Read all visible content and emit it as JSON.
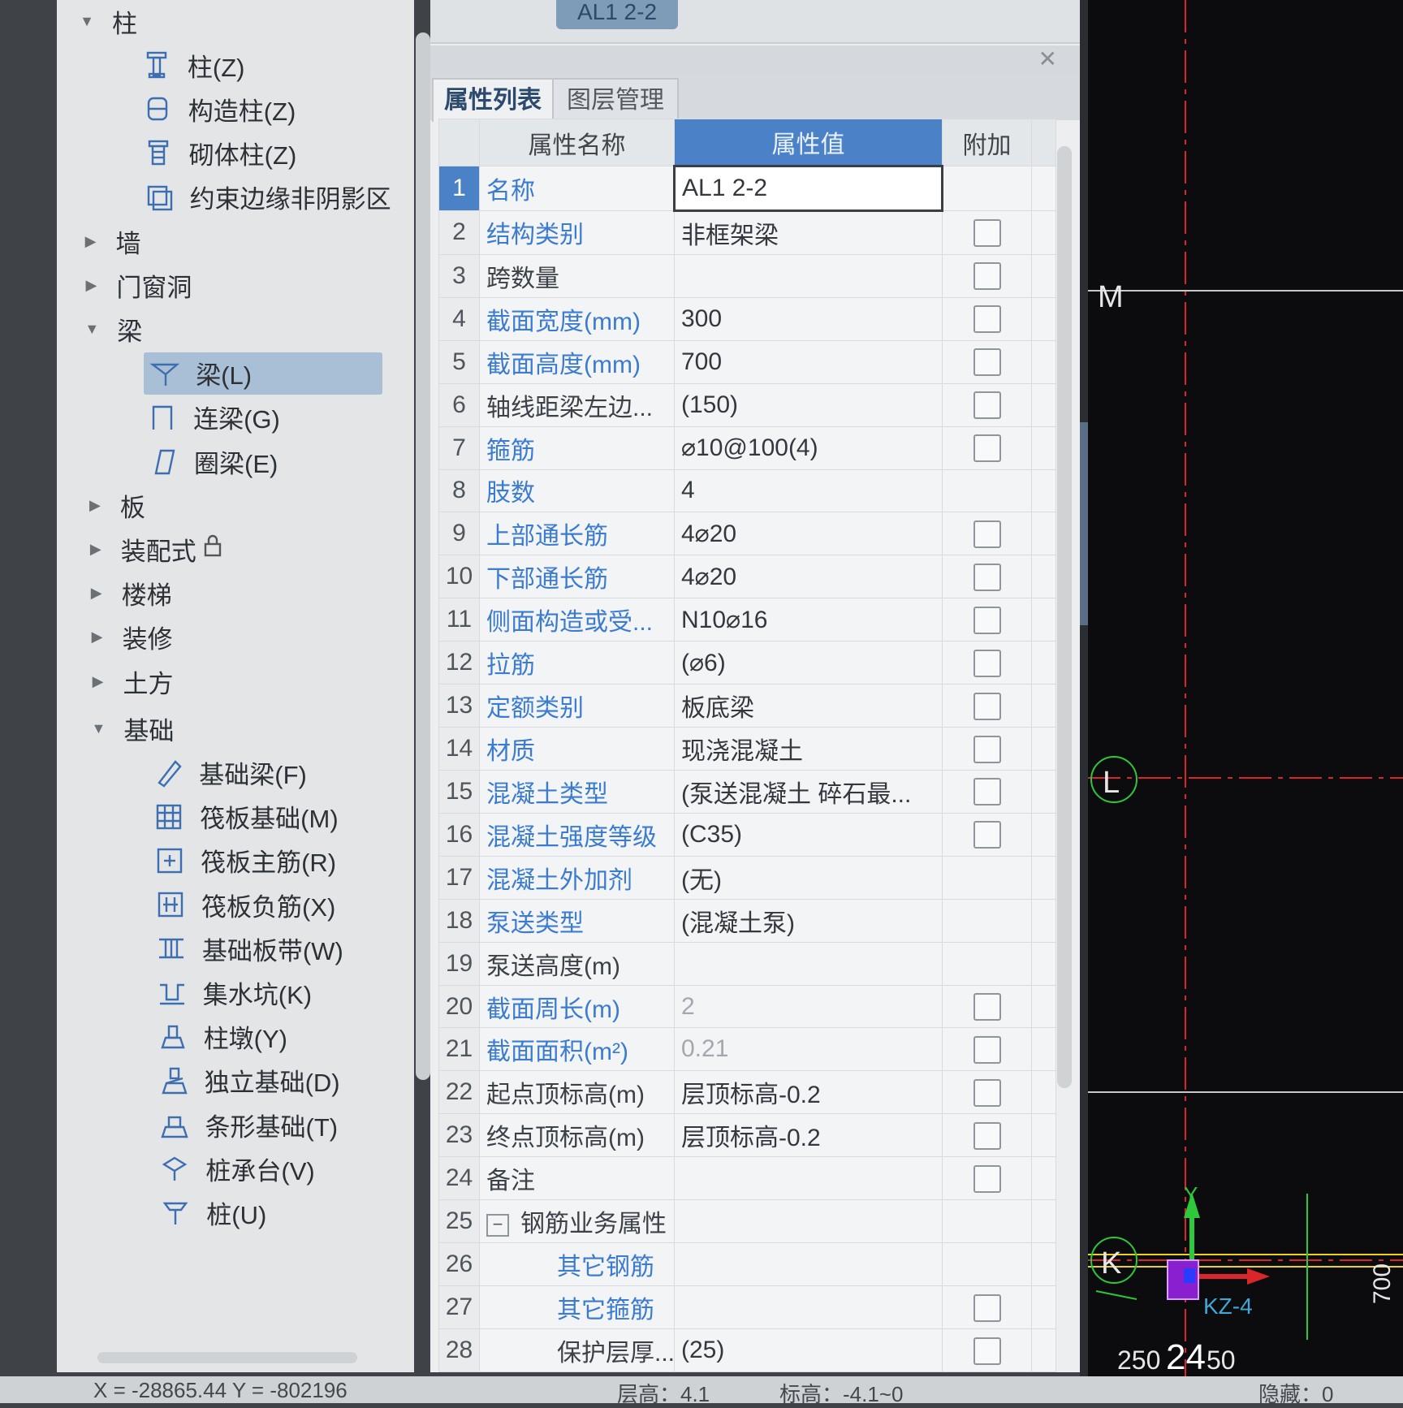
{
  "tree": {
    "nodes": [
      {
        "label": "柱",
        "kind": "group",
        "expanded": true
      },
      {
        "label": "柱(Z)",
        "kind": "item",
        "icon": "column-icon"
      },
      {
        "label": "构造柱(Z)",
        "kind": "item",
        "icon": "structural-column-icon"
      },
      {
        "label": "砌体柱(Z)",
        "kind": "item",
        "icon": "masonry-column-icon"
      },
      {
        "label": "约束边缘非阴影区",
        "kind": "item",
        "icon": "constraint-edge-icon"
      },
      {
        "label": "墙",
        "kind": "group",
        "expanded": false
      },
      {
        "label": "门窗洞",
        "kind": "group",
        "expanded": false
      },
      {
        "label": "梁",
        "kind": "group",
        "expanded": true
      },
      {
        "label": "梁(L)",
        "kind": "item",
        "icon": "beam-icon",
        "selected": true
      },
      {
        "label": "连梁(G)",
        "kind": "item",
        "icon": "coupling-beam-icon"
      },
      {
        "label": "圈梁(E)",
        "kind": "item",
        "icon": "ring-beam-icon"
      },
      {
        "label": "板",
        "kind": "group",
        "expanded": false
      },
      {
        "label": "装配式",
        "kind": "group",
        "expanded": false,
        "lock": true
      },
      {
        "label": "楼梯",
        "kind": "group",
        "expanded": false
      },
      {
        "label": "装修",
        "kind": "group",
        "expanded": false
      },
      {
        "label": "土方",
        "kind": "group",
        "expanded": false
      },
      {
        "label": "基础",
        "kind": "group",
        "expanded": true
      },
      {
        "label": "基础梁(F)",
        "kind": "item",
        "icon": "foundation-beam-icon"
      },
      {
        "label": "筏板基础(M)",
        "kind": "item",
        "icon": "raft-foundation-icon"
      },
      {
        "label": "筏板主筋(R)",
        "kind": "item",
        "icon": "raft-main-rebar-icon"
      },
      {
        "label": "筏板负筋(X)",
        "kind": "item",
        "icon": "raft-negative-rebar-icon"
      },
      {
        "label": "基础板带(W)",
        "kind": "item",
        "icon": "foundation-strip-icon"
      },
      {
        "label": "集水坑(K)",
        "kind": "item",
        "icon": "sump-pit-icon"
      },
      {
        "label": "柱墩(Y)",
        "kind": "item",
        "icon": "column-pier-icon"
      },
      {
        "label": "独立基础(D)",
        "kind": "item",
        "icon": "isolated-footing-icon"
      },
      {
        "label": "条形基础(T)",
        "kind": "item",
        "icon": "strip-footing-icon"
      },
      {
        "label": "桩承台(V)",
        "kind": "item",
        "icon": "pile-cap-icon"
      },
      {
        "label": "桩(U)",
        "kind": "item",
        "icon": "pile-icon"
      }
    ]
  },
  "top_chip": "AL1   2-2",
  "props": {
    "tabs": [
      {
        "label": "属性列表",
        "active": true
      },
      {
        "label": "图层管理",
        "active": false
      }
    ],
    "headers": {
      "name": "属性名称",
      "value": "属性值",
      "extra": "附加"
    },
    "rows": [
      {
        "n": "1",
        "name": "名称",
        "value": "AL1   2-2",
        "blue": true,
        "cb": false,
        "current": true
      },
      {
        "n": "2",
        "name": "结构类别",
        "value": "非框架梁",
        "blue": true,
        "cb": true
      },
      {
        "n": "3",
        "name": "跨数量",
        "value": "",
        "blue": false,
        "cb": true
      },
      {
        "n": "4",
        "name": "截面宽度(mm)",
        "value": "300",
        "blue": true,
        "cb": true
      },
      {
        "n": "5",
        "name": "截面高度(mm)",
        "value": "700",
        "blue": true,
        "cb": true
      },
      {
        "n": "6",
        "name": "轴线距梁左边...",
        "value": "(150)",
        "blue": false,
        "cb": true
      },
      {
        "n": "7",
        "name": "箍筋",
        "value": "⌀10@100(4)",
        "blue": true,
        "cb": true
      },
      {
        "n": "8",
        "name": "肢数",
        "value": "4",
        "blue": true,
        "cb": false
      },
      {
        "n": "9",
        "name": "上部通长筋",
        "value": "4⌀20",
        "blue": true,
        "cb": true
      },
      {
        "n": "10",
        "name": "下部通长筋",
        "value": "4⌀20",
        "blue": true,
        "cb": true
      },
      {
        "n": "11",
        "name": "侧面构造或受...",
        "value": "N10⌀16",
        "blue": true,
        "cb": true
      },
      {
        "n": "12",
        "name": "拉筋",
        "value": "(⌀6)",
        "blue": true,
        "cb": true
      },
      {
        "n": "13",
        "name": "定额类别",
        "value": "板底梁",
        "blue": true,
        "cb": true
      },
      {
        "n": "14",
        "name": "材质",
        "value": "现浇混凝土",
        "blue": true,
        "cb": true
      },
      {
        "n": "15",
        "name": "混凝土类型",
        "value": "(泵送混凝土 碎石最...",
        "blue": true,
        "cb": true
      },
      {
        "n": "16",
        "name": "混凝土强度等级",
        "value": "(C35)",
        "blue": true,
        "cb": true
      },
      {
        "n": "17",
        "name": "混凝土外加剂",
        "value": "(无)",
        "blue": true,
        "cb": false
      },
      {
        "n": "18",
        "name": "泵送类型",
        "value": "(混凝土泵)",
        "blue": true,
        "cb": false
      },
      {
        "n": "19",
        "name": "泵送高度(m)",
        "value": "",
        "blue": false,
        "cb": false
      },
      {
        "n": "20",
        "name": "截面周长(m)",
        "value": "2",
        "blue": true,
        "cb": true,
        "gray": true
      },
      {
        "n": "21",
        "name": "截面面积(m²)",
        "value": "0.21",
        "blue": true,
        "cb": true,
        "gray": true
      },
      {
        "n": "22",
        "name": "起点顶标高(m)",
        "value": "层顶标高-0.2",
        "blue": false,
        "cb": true
      },
      {
        "n": "23",
        "name": "终点顶标高(m)",
        "value": "层顶标高-0.2",
        "blue": false,
        "cb": true
      },
      {
        "n": "24",
        "name": "备注",
        "value": "",
        "blue": false,
        "cb": true
      },
      {
        "n": "25",
        "name": "钢筋业务属性",
        "value": "",
        "blue": false,
        "cb": false,
        "group": true
      },
      {
        "n": "26",
        "name": "其它钢筋",
        "value": "",
        "blue": true,
        "cb": false,
        "indent": true
      },
      {
        "n": "27",
        "name": "其它箍筋",
        "value": "",
        "blue": true,
        "cb": true,
        "indent": true
      },
      {
        "n": "28",
        "name": "保护层厚...",
        "value": "(25)",
        "blue": false,
        "cb": true,
        "indent": true
      }
    ]
  },
  "cad": {
    "axis_labels": [
      "M",
      "L",
      "K"
    ],
    "column_label": "KZ-4",
    "dim_bottom_left": "250",
    "dim_bottom_mid": "24",
    "dim_bottom_right": "50",
    "dim_right": "700",
    "axis_y_label": "Y",
    "colors": {
      "grid_red": "#d8262a",
      "axis_green": "#2ec83c",
      "column_purple": "#a020f0",
      "dim_cyan": "#3fa8d8"
    }
  },
  "status": {
    "coords": "X = -28865.44 Y = -802196",
    "floor_height_label": "层高：4.1",
    "elevation_label": "标高：-4.1~0",
    "hidden_label": "隐藏：0"
  }
}
